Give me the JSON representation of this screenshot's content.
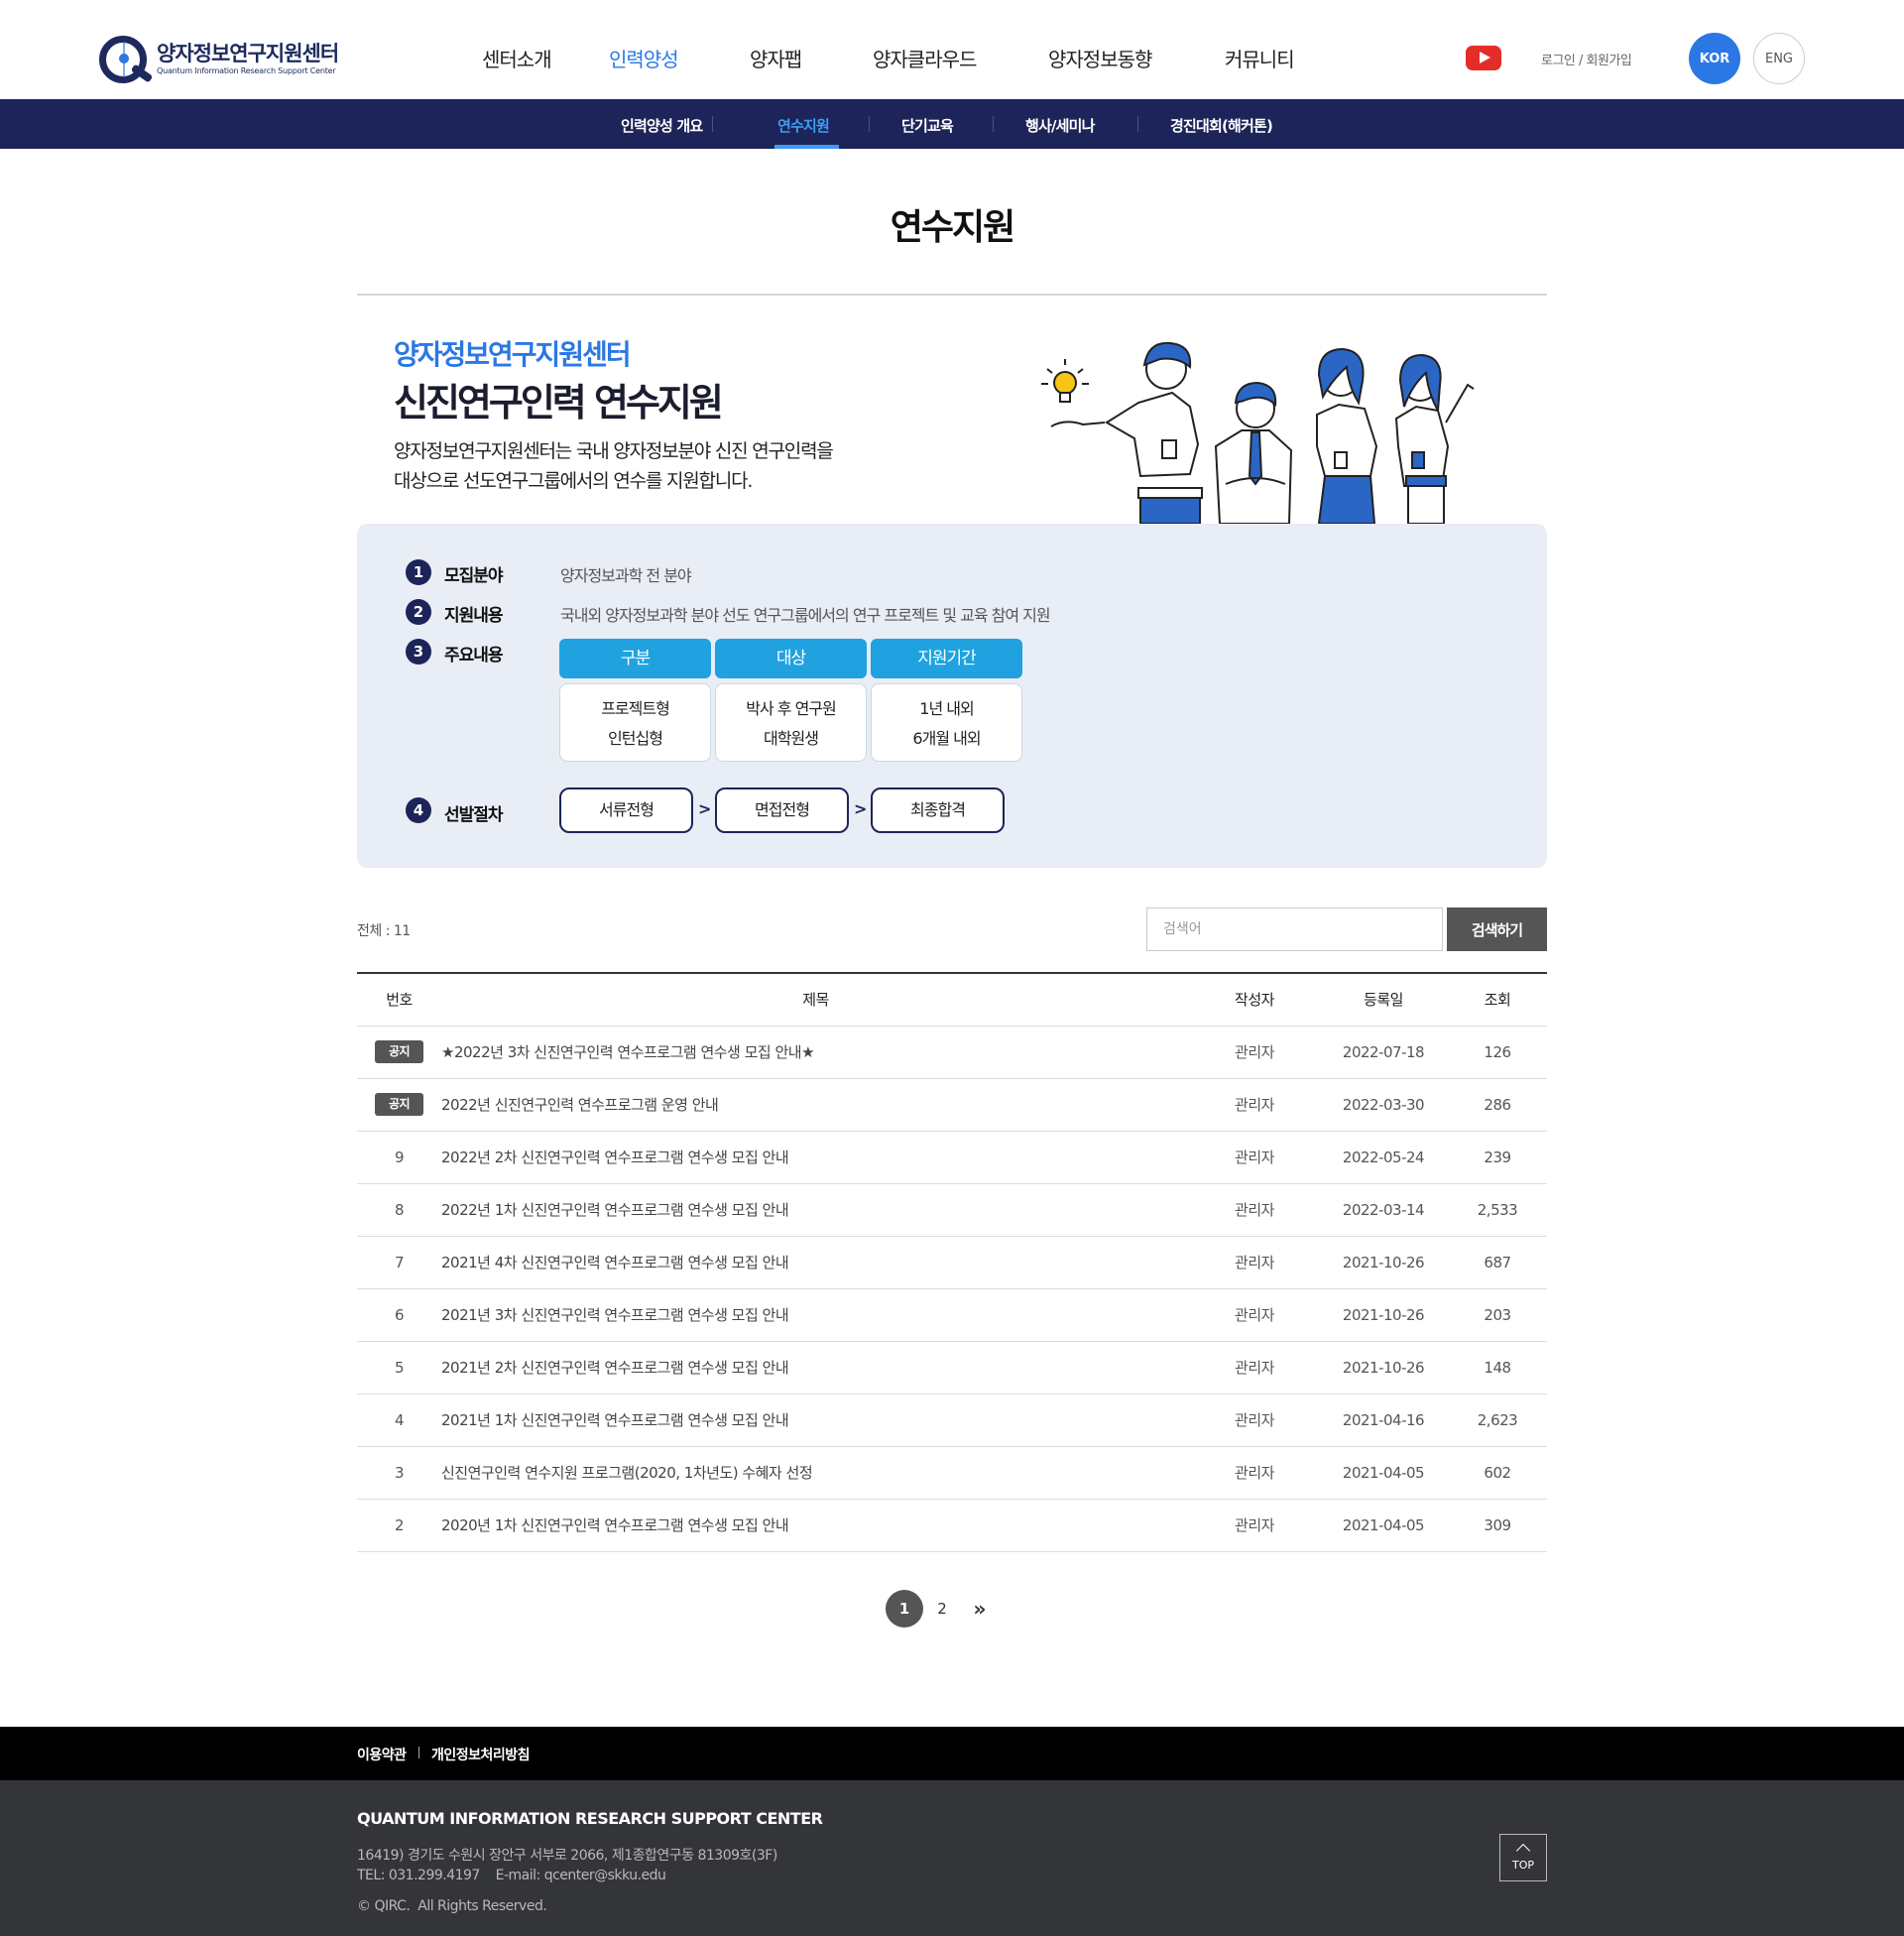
{
  "header": {
    "logo_ko": "양자정보연구지원센터",
    "logo_en": "Quantum Information Research Support Center",
    "gnb": [
      "센터소개",
      "인력양성",
      "양자팹",
      "양자클라우드",
      "양자정보동향",
      "커뮤니티"
    ],
    "gnb_active_index": 1,
    "youtube_icon": "youtube-icon",
    "login": "로그인 / 회원가입",
    "lang_kor": "KOR",
    "lang_eng": "ENG"
  },
  "lnb": {
    "items": [
      "인력양성 개요",
      "연수지원",
      "단기교육",
      "행사/세미나",
      "경진대회(해커톤)"
    ],
    "active_index": 1
  },
  "page": {
    "title": "연수지원"
  },
  "intro": {
    "sub": "양자정보연구지원센터",
    "main": "신진연구인력 연수지원",
    "desc_line1": "양자정보연구지원센터는 국내 양자정보분야 신진 연구인력을",
    "desc_line2": "대상으로 선도연구그룹에서의 연수를 지원합니다."
  },
  "info": {
    "items": [
      {
        "num": "1",
        "label": "모집분야",
        "value": "양자정보과학 전 분야"
      },
      {
        "num": "2",
        "label": "지원내용",
        "value": "국내외 양자정보과학 분야 선도 연구그룹에서의 연구 프로젝트 및 교육 참여 지원"
      },
      {
        "num": "3",
        "label": "주요내용"
      },
      {
        "num": "4",
        "label": "선발절차"
      }
    ],
    "table_headers": [
      "구분",
      "대상",
      "지원기간"
    ],
    "table_cells": [
      {
        "line1": "프로젝트형",
        "line2": "인턴십형"
      },
      {
        "line1": "박사 후 연구원",
        "line2": "대학원생"
      },
      {
        "line1": "1년 내외",
        "line2": "6개월 내외"
      }
    ],
    "steps": [
      "서류전형",
      "면접전형",
      "최종합격"
    ],
    "step_arrow": ">"
  },
  "board": {
    "total_label": "전체 : 11",
    "search_placeholder": "검색어",
    "search_button": "검색하기",
    "columns": [
      "번호",
      "제목",
      "작성자",
      "등록일",
      "조회"
    ],
    "notice_label": "공지",
    "rows": [
      {
        "no": "공지",
        "title": "★2022년 3차 신진연구인력 연수프로그램 연수생 모집 안내★",
        "author": "관리자",
        "date": "2022-07-18",
        "views": "126"
      },
      {
        "no": "공지",
        "title": "2022년 신진연구인력 연수프로그램 운영 안내",
        "author": "관리자",
        "date": "2022-03-30",
        "views": "286"
      },
      {
        "no": "9",
        "title": "2022년 2차 신진연구인력 연수프로그램 연수생 모집 안내",
        "author": "관리자",
        "date": "2022-05-24",
        "views": "239"
      },
      {
        "no": "8",
        "title": "2022년 1차 신진연구인력 연수프로그램 연수생 모집 안내",
        "author": "관리자",
        "date": "2022-03-14",
        "views": "2,533"
      },
      {
        "no": "7",
        "title": "2021년 4차 신진연구인력 연수프로그램 연수생 모집 안내",
        "author": "관리자",
        "date": "2021-10-26",
        "views": "687"
      },
      {
        "no": "6",
        "title": "2021년 3차 신진연구인력 연수프로그램 연수생 모집 안내",
        "author": "관리자",
        "date": "2021-10-26",
        "views": "203"
      },
      {
        "no": "5",
        "title": "2021년 2차 신진연구인력 연수프로그램 연수생 모집 안내",
        "author": "관리자",
        "date": "2021-10-26",
        "views": "148"
      },
      {
        "no": "4",
        "title": "2021년 1차 신진연구인력 연수프로그램 연수생 모집 안내",
        "author": "관리자",
        "date": "2021-04-16",
        "views": "2,623"
      },
      {
        "no": "3",
        "title": "신진연구인력 연수지원 프로그램(2020, 1차년도) 수혜자 선정",
        "author": "관리자",
        "date": "2021-04-05",
        "views": "602"
      },
      {
        "no": "2",
        "title": "2020년 1차 신진연구인력 연수프로그램 연수생 모집 안내",
        "author": "관리자",
        "date": "2021-04-05",
        "views": "309"
      }
    ]
  },
  "pager": {
    "current": "1",
    "pages": [
      "1",
      "2"
    ],
    "next": "»"
  },
  "footer": {
    "links": [
      "이용약관",
      "개인정보처리방침"
    ],
    "name": "QUANTUM INFORMATION RESEARCH SUPPORT CENTER",
    "address": "16419) 경기도 수원시 장안구 서부로 2066, 제1종합연구동 81309호(3F)",
    "contact": "TEL: 031.299.4197    E-mail: qcenter@skku.edu",
    "copyright": "© QIRC.  All Rights Reserved.",
    "top_label": "TOP"
  },
  "colors": {
    "navy": "#1d2459",
    "blue": "#2b78e4",
    "cyan": "#1fa2df",
    "info_bg": "#e9edf5"
  }
}
